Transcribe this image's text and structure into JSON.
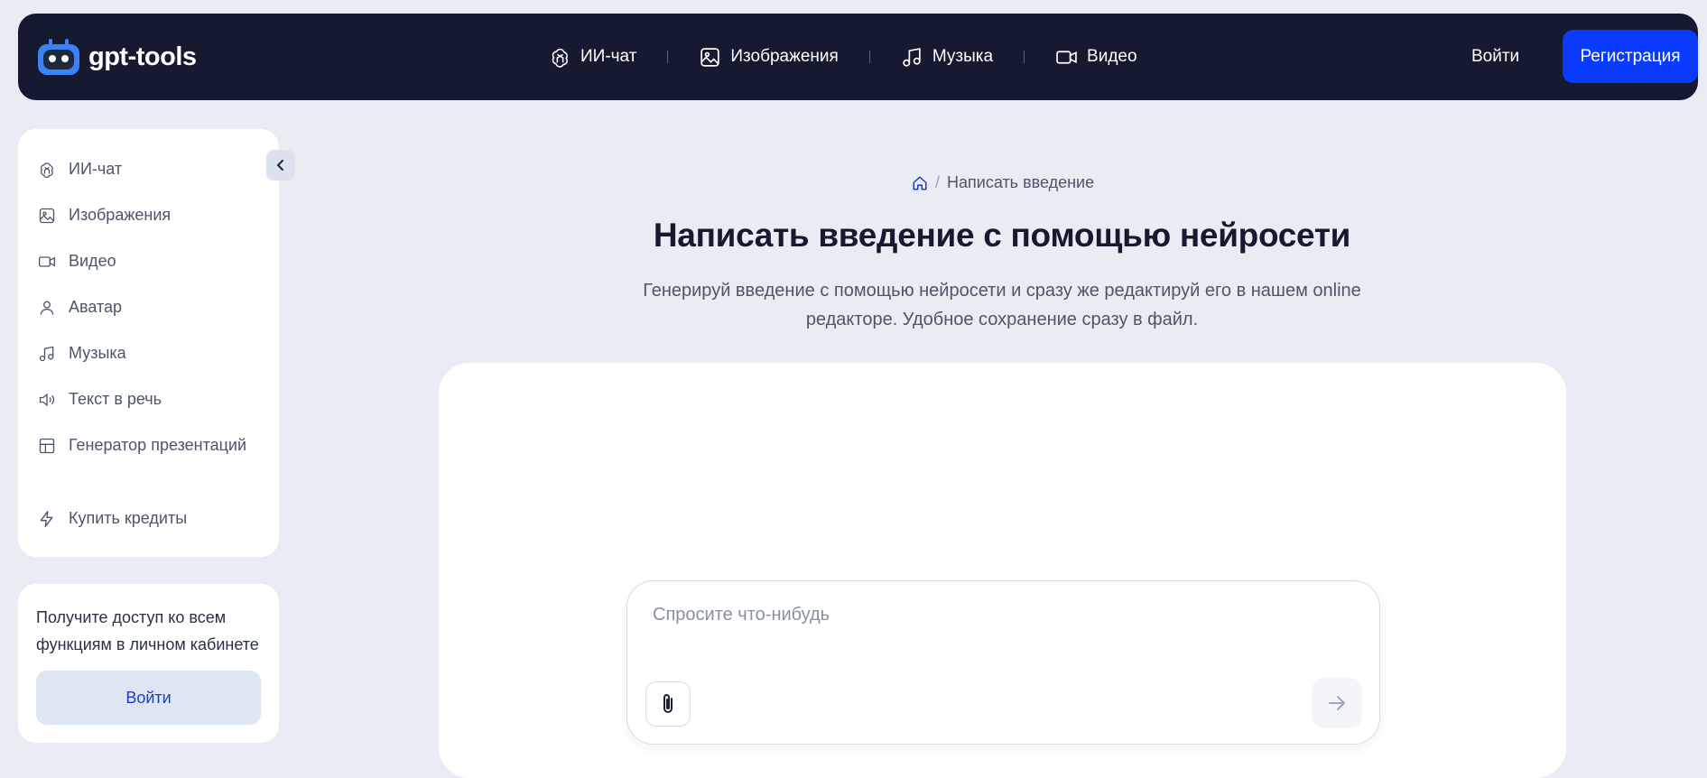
{
  "header": {
    "logo_text": "gpt-tools",
    "nav": [
      {
        "label": "ИИ-чат",
        "icon": "openai-icon"
      },
      {
        "label": "Изображения",
        "icon": "image-icon"
      },
      {
        "label": "Музыка",
        "icon": "music-icon"
      },
      {
        "label": "Видео",
        "icon": "video-icon"
      }
    ],
    "login_label": "Войти",
    "register_label": "Регистрация"
  },
  "sidebar": {
    "items": [
      {
        "label": "ИИ-чат",
        "icon": "openai-icon"
      },
      {
        "label": "Изображения",
        "icon": "image-icon"
      },
      {
        "label": "Видео",
        "icon": "video-icon"
      },
      {
        "label": "Аватар",
        "icon": "user-icon"
      },
      {
        "label": "Музыка",
        "icon": "music-icon"
      },
      {
        "label": "Текст в речь",
        "icon": "speaker-icon"
      },
      {
        "label": "Генератор презентаций",
        "icon": "presentation-icon"
      },
      {
        "label": "Купить кредиты",
        "icon": "lightning-icon"
      }
    ],
    "promo": {
      "text": "Получите доступ ко всем функциям в личном кабинете",
      "button_label": "Войти"
    }
  },
  "main": {
    "breadcrumb": {
      "current": "Написать введение"
    },
    "title": "Написать введение с помощью нейросети",
    "description": "Генерируй введение с помощью нейросети и сразу же редактируй его в нашем online редакторе. Удобное сохранение сразу в файл.",
    "prompt": {
      "placeholder": "Спросите что-нибудь",
      "value": ""
    }
  },
  "colors": {
    "header_bg": "#151a30",
    "page_bg": "#e9ecf3",
    "accent": "#0a3bff",
    "link": "#1b3ccf"
  }
}
